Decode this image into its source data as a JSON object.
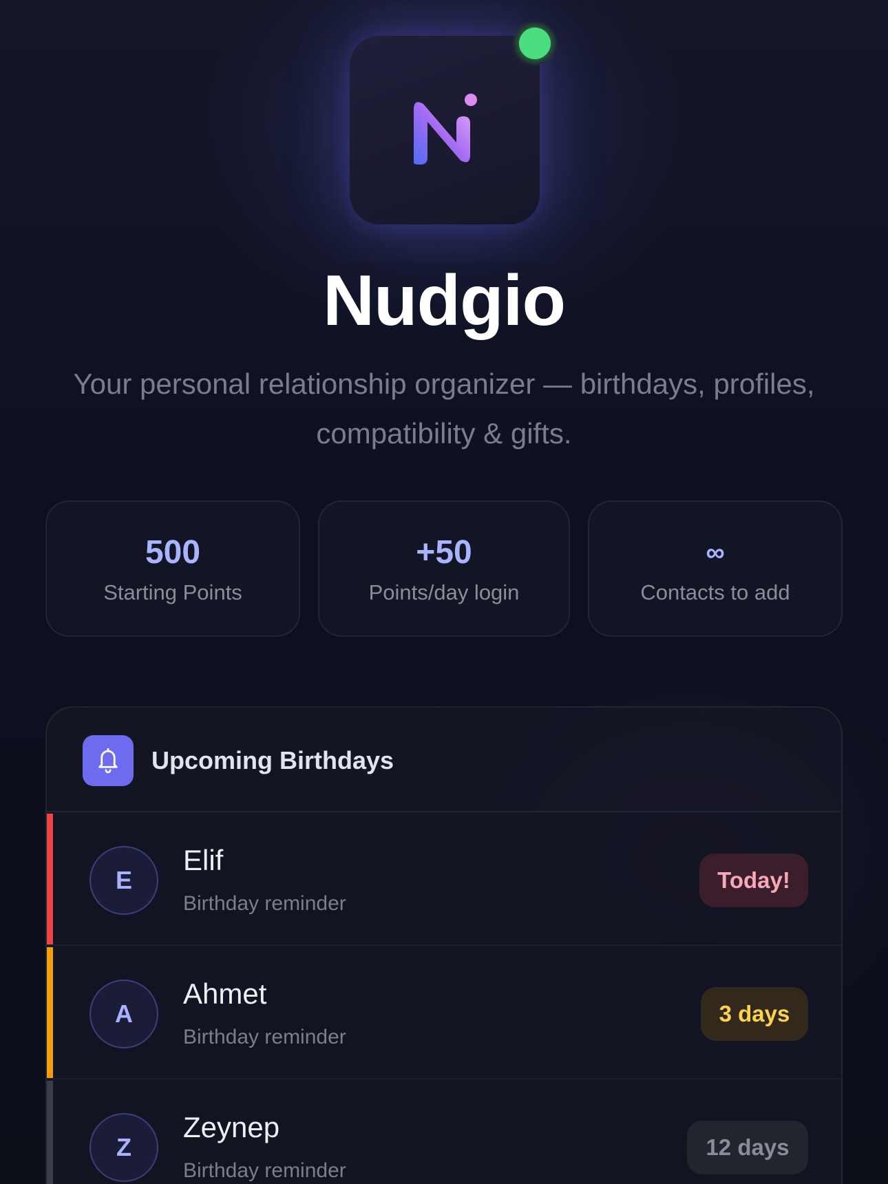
{
  "app": {
    "title": "Nudgio",
    "tagline": "Your personal relationship organizer — birthdays, profiles, compatibility & gifts.",
    "status_color": "#4ade80"
  },
  "stats": [
    {
      "value": "500",
      "label": "Starting Points"
    },
    {
      "value": "+50",
      "label": "Points/day login"
    },
    {
      "value": "∞",
      "label": "Contacts to add"
    }
  ],
  "birthdays": {
    "title": "Upcoming Birthdays",
    "icon": "bell-icon",
    "items": [
      {
        "initial": "E",
        "name": "Elif",
        "subtitle": "Birthday reminder",
        "badge": "Today!",
        "accent": "#ef4444"
      },
      {
        "initial": "A",
        "name": "Ahmet",
        "subtitle": "Birthday reminder",
        "badge": "3 days",
        "accent": "#f59e0b"
      },
      {
        "initial": "Z",
        "name": "Zeynep",
        "subtitle": "Birthday reminder",
        "badge": "12 days",
        "accent": "#3a3d4a"
      }
    ]
  }
}
